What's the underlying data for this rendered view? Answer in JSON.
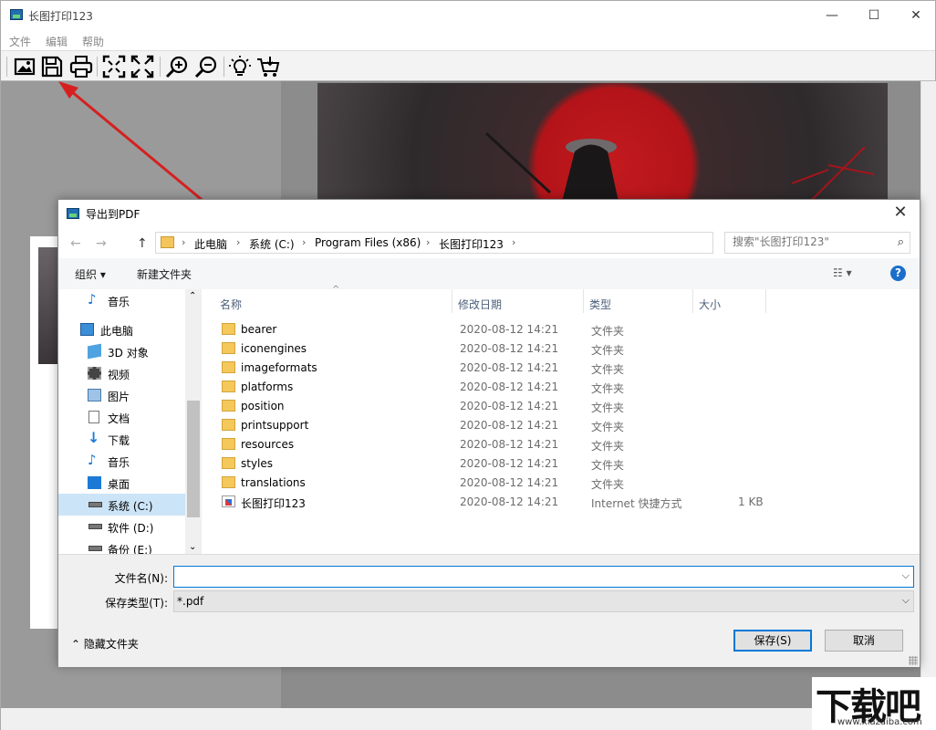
{
  "app": {
    "title": "长图打印123",
    "menu": [
      "文件",
      "编辑",
      "帮助"
    ],
    "window_controls": {
      "minimize": "—",
      "maximize": "☐",
      "close": "✕"
    },
    "toolbar_icons": [
      "open-image-icon",
      "save-icon",
      "print-icon",
      "fit-page-icon",
      "actual-size-icon",
      "zoom-in-icon",
      "zoom-out-icon",
      "tip-icon",
      "cart-icon"
    ],
    "annotation_arrow_color": "#d62020"
  },
  "dialog": {
    "title": "导出到PDF",
    "close": "✕",
    "nav": {
      "back": "←",
      "forward": "→",
      "up": "↑"
    },
    "breadcrumb": [
      "此电脑",
      "系统 (C:)",
      "Program Files (x86)",
      "长图打印123"
    ],
    "search": {
      "placeholder": "搜索\"长图打印123\""
    },
    "commands": {
      "organize": "组织 ▾",
      "new_folder": "新建文件夹",
      "view": "☷ ▾",
      "help": "?"
    },
    "nav_pane": [
      {
        "label": "音乐",
        "icon": "music-icon"
      },
      {
        "label": "此电脑",
        "icon": "computer-icon"
      },
      {
        "label": "3D 对象",
        "icon": "3d-objects-icon"
      },
      {
        "label": "视频",
        "icon": "video-icon"
      },
      {
        "label": "图片",
        "icon": "pictures-icon"
      },
      {
        "label": "文档",
        "icon": "documents-icon"
      },
      {
        "label": "下载",
        "icon": "download-icon"
      },
      {
        "label": "音乐",
        "icon": "music-icon"
      },
      {
        "label": "桌面",
        "icon": "desktop-icon"
      },
      {
        "label": "系统 (C:)",
        "icon": "drive-icon",
        "selected": true
      },
      {
        "label": "软件 (D:)",
        "icon": "drive-icon"
      },
      {
        "label": "备份 (E:)",
        "icon": "drive-icon"
      }
    ],
    "columns": [
      "名称",
      "修改日期",
      "类型",
      "大小"
    ],
    "files": [
      {
        "name": "bearer",
        "date": "2020-08-12 14:21",
        "type": "文件夹",
        "size": ""
      },
      {
        "name": "iconengines",
        "date": "2020-08-12 14:21",
        "type": "文件夹",
        "size": ""
      },
      {
        "name": "imageformats",
        "date": "2020-08-12 14:21",
        "type": "文件夹",
        "size": ""
      },
      {
        "name": "platforms",
        "date": "2020-08-12 14:21",
        "type": "文件夹",
        "size": ""
      },
      {
        "name": "position",
        "date": "2020-08-12 14:21",
        "type": "文件夹",
        "size": ""
      },
      {
        "name": "printsupport",
        "date": "2020-08-12 14:21",
        "type": "文件夹",
        "size": ""
      },
      {
        "name": "resources",
        "date": "2020-08-12 14:21",
        "type": "文件夹",
        "size": ""
      },
      {
        "name": "styles",
        "date": "2020-08-12 14:21",
        "type": "文件夹",
        "size": ""
      },
      {
        "name": "translations",
        "date": "2020-08-12 14:21",
        "type": "文件夹",
        "size": ""
      },
      {
        "name": "长图打印123",
        "date": "2020-08-12 14:21",
        "type": "Internet 快捷方式",
        "size": "1 KB",
        "shortcut": true
      }
    ],
    "filename_label": "文件名(N):",
    "filename_value": "",
    "filetype_label": "保存类型(T):",
    "filetype_value": "*.pdf",
    "hide_folders": "隐藏文件夹",
    "save_button": "保存(S)",
    "cancel_button": "取消"
  },
  "watermark": {
    "text": "下载吧",
    "url": "www.xiazaiba.com"
  }
}
